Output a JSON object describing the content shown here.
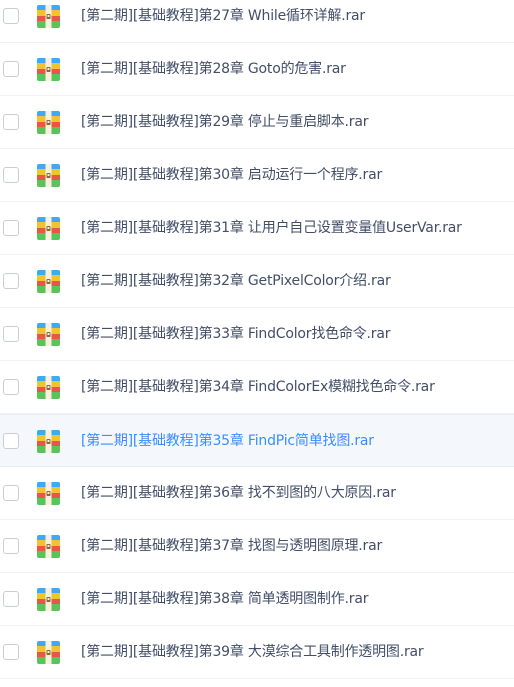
{
  "files": [
    {
      "name": "[第二期][基础教程]第27章 While循环详解.rar",
      "hover": false
    },
    {
      "name": "[第二期][基础教程]第28章 Goto的危害.rar",
      "hover": false
    },
    {
      "name": "[第二期][基础教程]第29章 停止与重启脚本.rar",
      "hover": false
    },
    {
      "name": "[第二期][基础教程]第30章 启动运行一个程序.rar",
      "hover": false
    },
    {
      "name": "[第二期][基础教程]第31章 让用户自己设置变量值UserVar.rar",
      "hover": false
    },
    {
      "name": "[第二期][基础教程]第32章 GetPixelColor介绍.rar",
      "hover": false
    },
    {
      "name": "[第二期][基础教程]第33章 FindColor找色命令.rar",
      "hover": false
    },
    {
      "name": "[第二期][基础教程]第34章 FindColorEx模糊找色命令.rar",
      "hover": false
    },
    {
      "name": "[第二期][基础教程]第35章 FindPic简单找图.rar",
      "hover": true
    },
    {
      "name": "[第二期][基础教程]第36章 找不到图的八大原因.rar",
      "hover": false
    },
    {
      "name": "[第二期][基础教程]第37章 找图与透明图原理.rar",
      "hover": false
    },
    {
      "name": "[第二期][基础教程]第38章 简单透明图制作.rar",
      "hover": false
    },
    {
      "name": "[第二期][基础教程]第39章 大漠综合工具制作透明图.rar",
      "hover": false
    }
  ],
  "icon": "archive-rar-icon",
  "colors": {
    "text": "#424e67",
    "hover_text": "#3b8cff",
    "hover_bg": "#f4f8fd",
    "checkbox_border": "#c9cdd4"
  }
}
